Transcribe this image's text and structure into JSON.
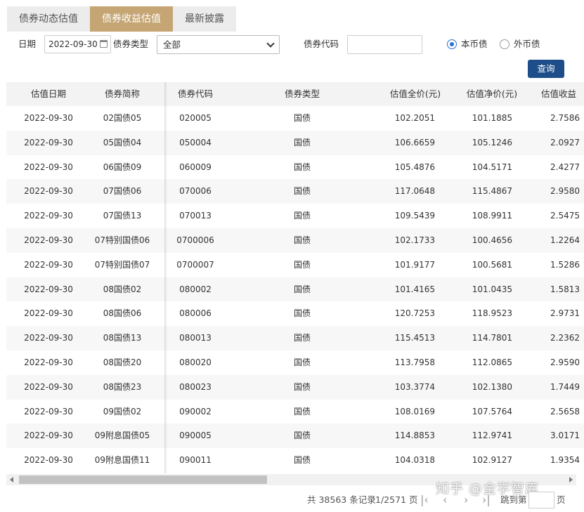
{
  "tabs": [
    {
      "label": "债券动态估值",
      "active": false
    },
    {
      "label": "债券收益估值",
      "active": true
    },
    {
      "label": "最新披露",
      "active": false
    }
  ],
  "filters": {
    "date_label": "日期",
    "date_value": "2022-09-30",
    "type_label": "债券类型",
    "type_value": "全部",
    "code_label": "债券代码",
    "code_value": "",
    "radio_local": "本币债",
    "radio_foreign": "外币债",
    "selected_radio": "本币债",
    "query_label": "查询"
  },
  "table": {
    "headers": [
      "估值日期",
      "债券简称",
      "债券代码",
      "债券类型",
      "估值全价(元)",
      "估值净价(元)",
      "估值收益"
    ],
    "rows": [
      [
        "2022-09-30",
        "02国债05",
        "020005",
        "国债",
        "102.2051",
        "101.1885",
        "2.7586"
      ],
      [
        "2022-09-30",
        "05国债04",
        "050004",
        "国债",
        "106.6659",
        "105.1246",
        "2.0927"
      ],
      [
        "2022-09-30",
        "06国债09",
        "060009",
        "国债",
        "105.4876",
        "104.5171",
        "2.4277"
      ],
      [
        "2022-09-30",
        "07国债06",
        "070006",
        "国债",
        "117.0648",
        "115.4867",
        "2.9580"
      ],
      [
        "2022-09-30",
        "07国债13",
        "070013",
        "国债",
        "109.5439",
        "108.9911",
        "2.5475"
      ],
      [
        "2022-09-30",
        "07特别国债06",
        "0700006",
        "国债",
        "102.1733",
        "100.4656",
        "1.2264"
      ],
      [
        "2022-09-30",
        "07特别国债07",
        "0700007",
        "国债",
        "101.9177",
        "100.5681",
        "1.5286"
      ],
      [
        "2022-09-30",
        "08国债02",
        "080002",
        "国债",
        "101.4165",
        "101.0435",
        "1.5813"
      ],
      [
        "2022-09-30",
        "08国债06",
        "080006",
        "国债",
        "120.7253",
        "118.9523",
        "2.9731"
      ],
      [
        "2022-09-30",
        "08国债13",
        "080013",
        "国债",
        "115.4513",
        "114.7801",
        "2.2362"
      ],
      [
        "2022-09-30",
        "08国债20",
        "080020",
        "国债",
        "113.7958",
        "112.0865",
        "2.9590"
      ],
      [
        "2022-09-30",
        "08国债23",
        "080023",
        "国债",
        "103.3774",
        "102.1380",
        "1.7449"
      ],
      [
        "2022-09-30",
        "09国债02",
        "090002",
        "国债",
        "108.0169",
        "107.5764",
        "2.5658"
      ],
      [
        "2022-09-30",
        "09附息国债05",
        "090005",
        "国债",
        "114.8853",
        "112.9741",
        "3.0171"
      ],
      [
        "2022-09-30",
        "09附息国债11",
        "090011",
        "国债",
        "104.0318",
        "102.9127",
        "1.9354"
      ]
    ]
  },
  "pagination": {
    "total": "共 38563 条记录",
    "page": "1/2571 页",
    "jump_label": "跳到第",
    "page_suffix": "页"
  },
  "watermark": "知乎 @金学智库",
  "colors": {
    "active_tab": "#c5a574",
    "query_button": "#1d4e89",
    "radio": "#2a6fd6"
  },
  "icons": [
    "calendar-icon",
    "chevron-down-icon",
    "first-page-icon",
    "prev-page-icon",
    "next-page-icon",
    "last-page-icon"
  ]
}
